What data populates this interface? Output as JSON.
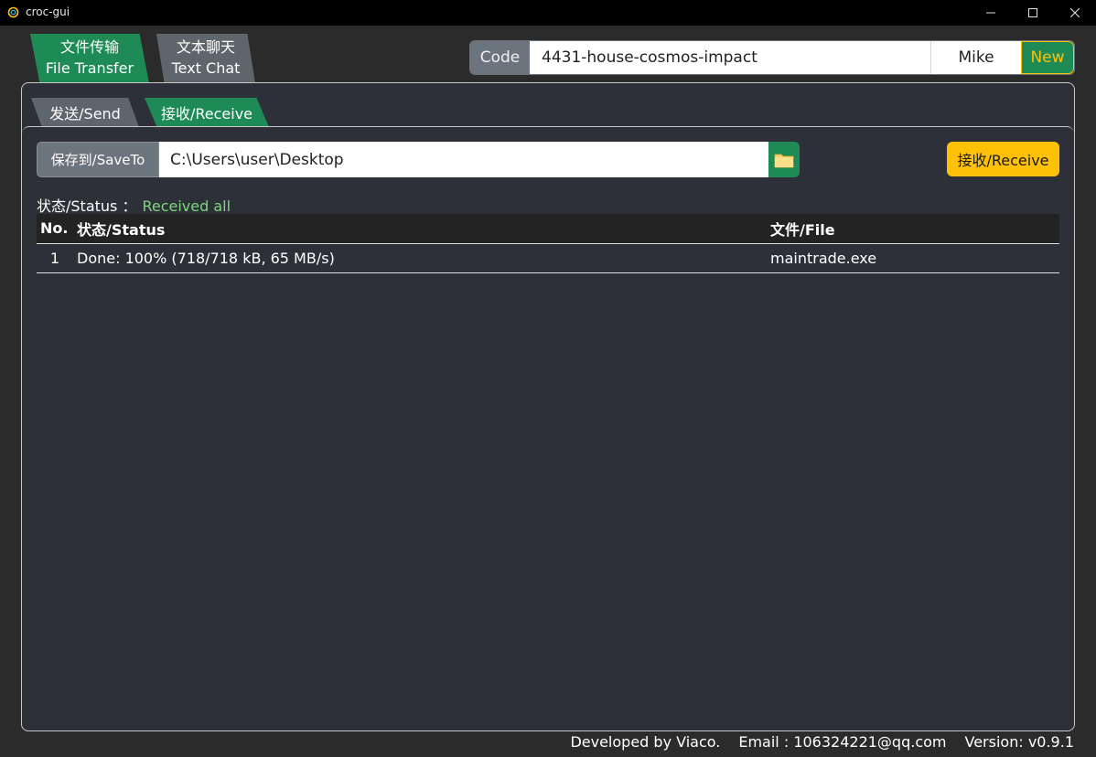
{
  "window": {
    "title": "croc-gui",
    "minimize_icon": "minimize-icon",
    "maximize_icon": "maximize-icon",
    "close_icon": "close-icon"
  },
  "top_tabs": [
    {
      "label_cn": "文件传输",
      "label_en": "File Transfer",
      "active": true
    },
    {
      "label_cn": "文本聊天",
      "label_en": "Text Chat",
      "active": false
    }
  ],
  "code_bar": {
    "label": "Code",
    "code_value": "4431-house-cosmos-impact",
    "user": "Mike",
    "new_button": "New"
  },
  "sub_tabs": [
    {
      "label": "发送/Send",
      "active": false
    },
    {
      "label": "接收/Receive",
      "active": true
    }
  ],
  "save_to": {
    "label": "保存到/SaveTo",
    "path": "C:\\Users\\user\\Desktop",
    "folder_icon": "folder-icon"
  },
  "receive_button": "接收/Receive",
  "status": {
    "label": "状态/Status ：",
    "value": "Received all"
  },
  "table": {
    "headers": [
      "No.",
      "状态/Status",
      "文件/File"
    ],
    "rows": [
      {
        "no": "1",
        "status": "Done: 100% (718/718 kB, 65 MB/s)",
        "file": "maintrade.exe"
      }
    ]
  },
  "footer": {
    "developer": "Developed by Viaco.",
    "email": "Email : 106324221@qq.com",
    "version": "Version: v0.9.1"
  },
  "colors": {
    "accent_green": "#1e8a55",
    "accent_yellow": "#ffc107",
    "status_green": "#7ed67e",
    "panel_bg": "#2d3038"
  }
}
